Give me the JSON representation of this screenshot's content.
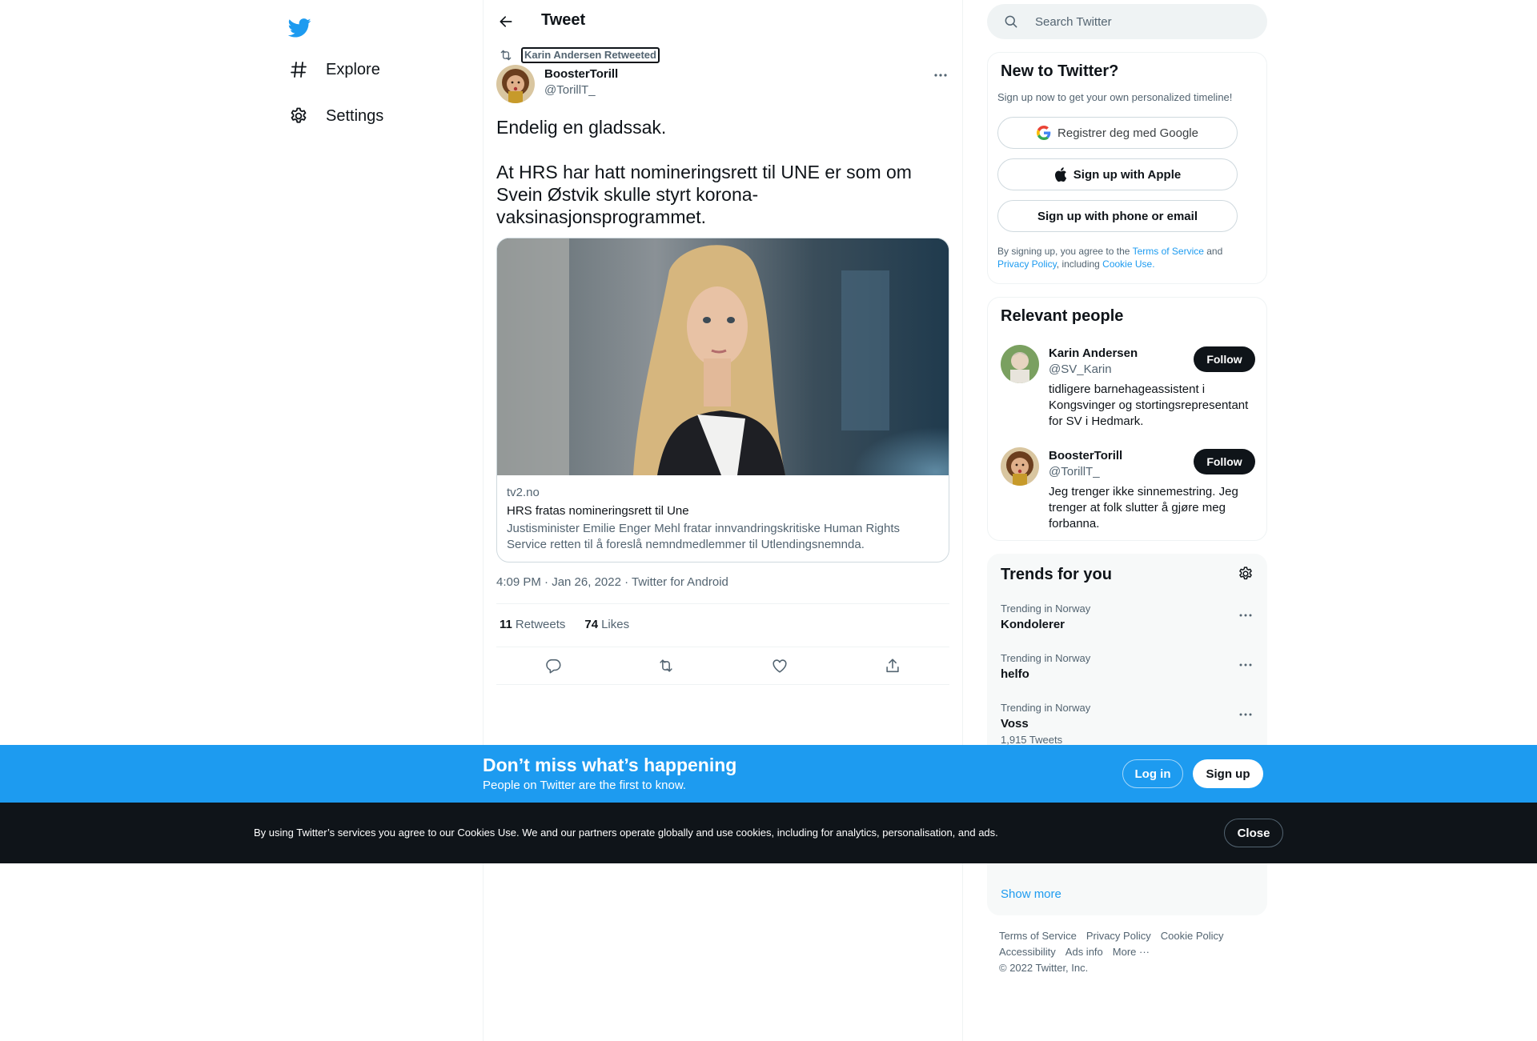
{
  "app": {
    "brand_color": "#1d9bf0",
    "logo_icon": "twitter-bird-icon"
  },
  "nav": {
    "items": [
      {
        "label": "Explore",
        "icon": "hashtag-icon"
      },
      {
        "label": "Settings",
        "icon": "gear-icon"
      }
    ]
  },
  "header": {
    "title": "Tweet",
    "back_icon": "back-arrow-icon"
  },
  "tweet": {
    "retweeted_by": "Karin Andersen Retweeted",
    "author_name": "BoosterTorill",
    "author_handle": "@TorillT_",
    "text": "Endelig en gladssak.\n\nAt HRS har hatt nomineringsrett til UNE er som om Svein Østvik skulle styrt korona-vaksinasjonsprogrammet.",
    "card": {
      "domain": "tv2.no",
      "title": "HRS fratas nomineringsrett til Une",
      "description": "Justisminister Emilie Enger Mehl fratar innvandringskritiske Human Rights Service retten til å foreslå nemndmedlemmer til Utlendingsnemnda."
    },
    "time": "4:09 PM · Jan 26, 2022",
    "separator": " · ",
    "source": "Twitter for Android",
    "retweets_count": "11",
    "retweets_label": "Retweets",
    "likes_count": "74",
    "likes_label": "Likes"
  },
  "search": {
    "placeholder": "Search Twitter"
  },
  "new_to_twitter": {
    "title": "New to Twitter?",
    "subtitle": "Sign up now to get your own personalized timeline!",
    "google_label": "Registrer deg med Google",
    "apple_label": "Sign up with Apple",
    "phone_label": "Sign up with phone or email",
    "legal_prefix": "By signing up, you agree to the ",
    "terms": "Terms of Service",
    "and": " and ",
    "privacy": "Privacy Policy",
    "including": ", including ",
    "cookie": "Cookie Use."
  },
  "relevant_people": {
    "title": "Relevant people",
    "follow_label": "Follow",
    "people": [
      {
        "name": "Karin Andersen",
        "handle": "@SV_Karin",
        "bio": "tidligere barnehageassistent i Kongsvinger og stortingsrepresentant for SV i Hedmark."
      },
      {
        "name": "BoosterTorill",
        "handle": "@TorillT_",
        "bio": "Jeg trenger ikke sinnemestring. Jeg trenger at folk slutter å gjøre meg forbanna."
      }
    ]
  },
  "trends": {
    "title": "Trends for you",
    "items": [
      {
        "context": "Trending in Norway",
        "name": "Kondolerer",
        "count": ""
      },
      {
        "context": "Trending in Norway",
        "name": "helfo",
        "count": ""
      },
      {
        "context": "Trending in Norway",
        "name": "Voss",
        "count": "1,915 Tweets"
      }
    ],
    "show_more": "Show more"
  },
  "footer": {
    "links": [
      "Terms of Service",
      "Privacy Policy",
      "Cookie Policy",
      "Accessibility",
      "Ads info",
      "More ···"
    ],
    "copyright": "© 2022 Twitter, Inc."
  },
  "signup_banner": {
    "title": "Don’t miss what’s happening",
    "subtitle": "People on Twitter are the first to know.",
    "login_label": "Log in",
    "signup_label": "Sign up"
  },
  "cookie_banner": {
    "text": "By using Twitter’s services you agree to our Cookies Use. We and our partners operate globally and use cookies, including for analytics, personalisation, and ads.",
    "close_label": "Close"
  }
}
